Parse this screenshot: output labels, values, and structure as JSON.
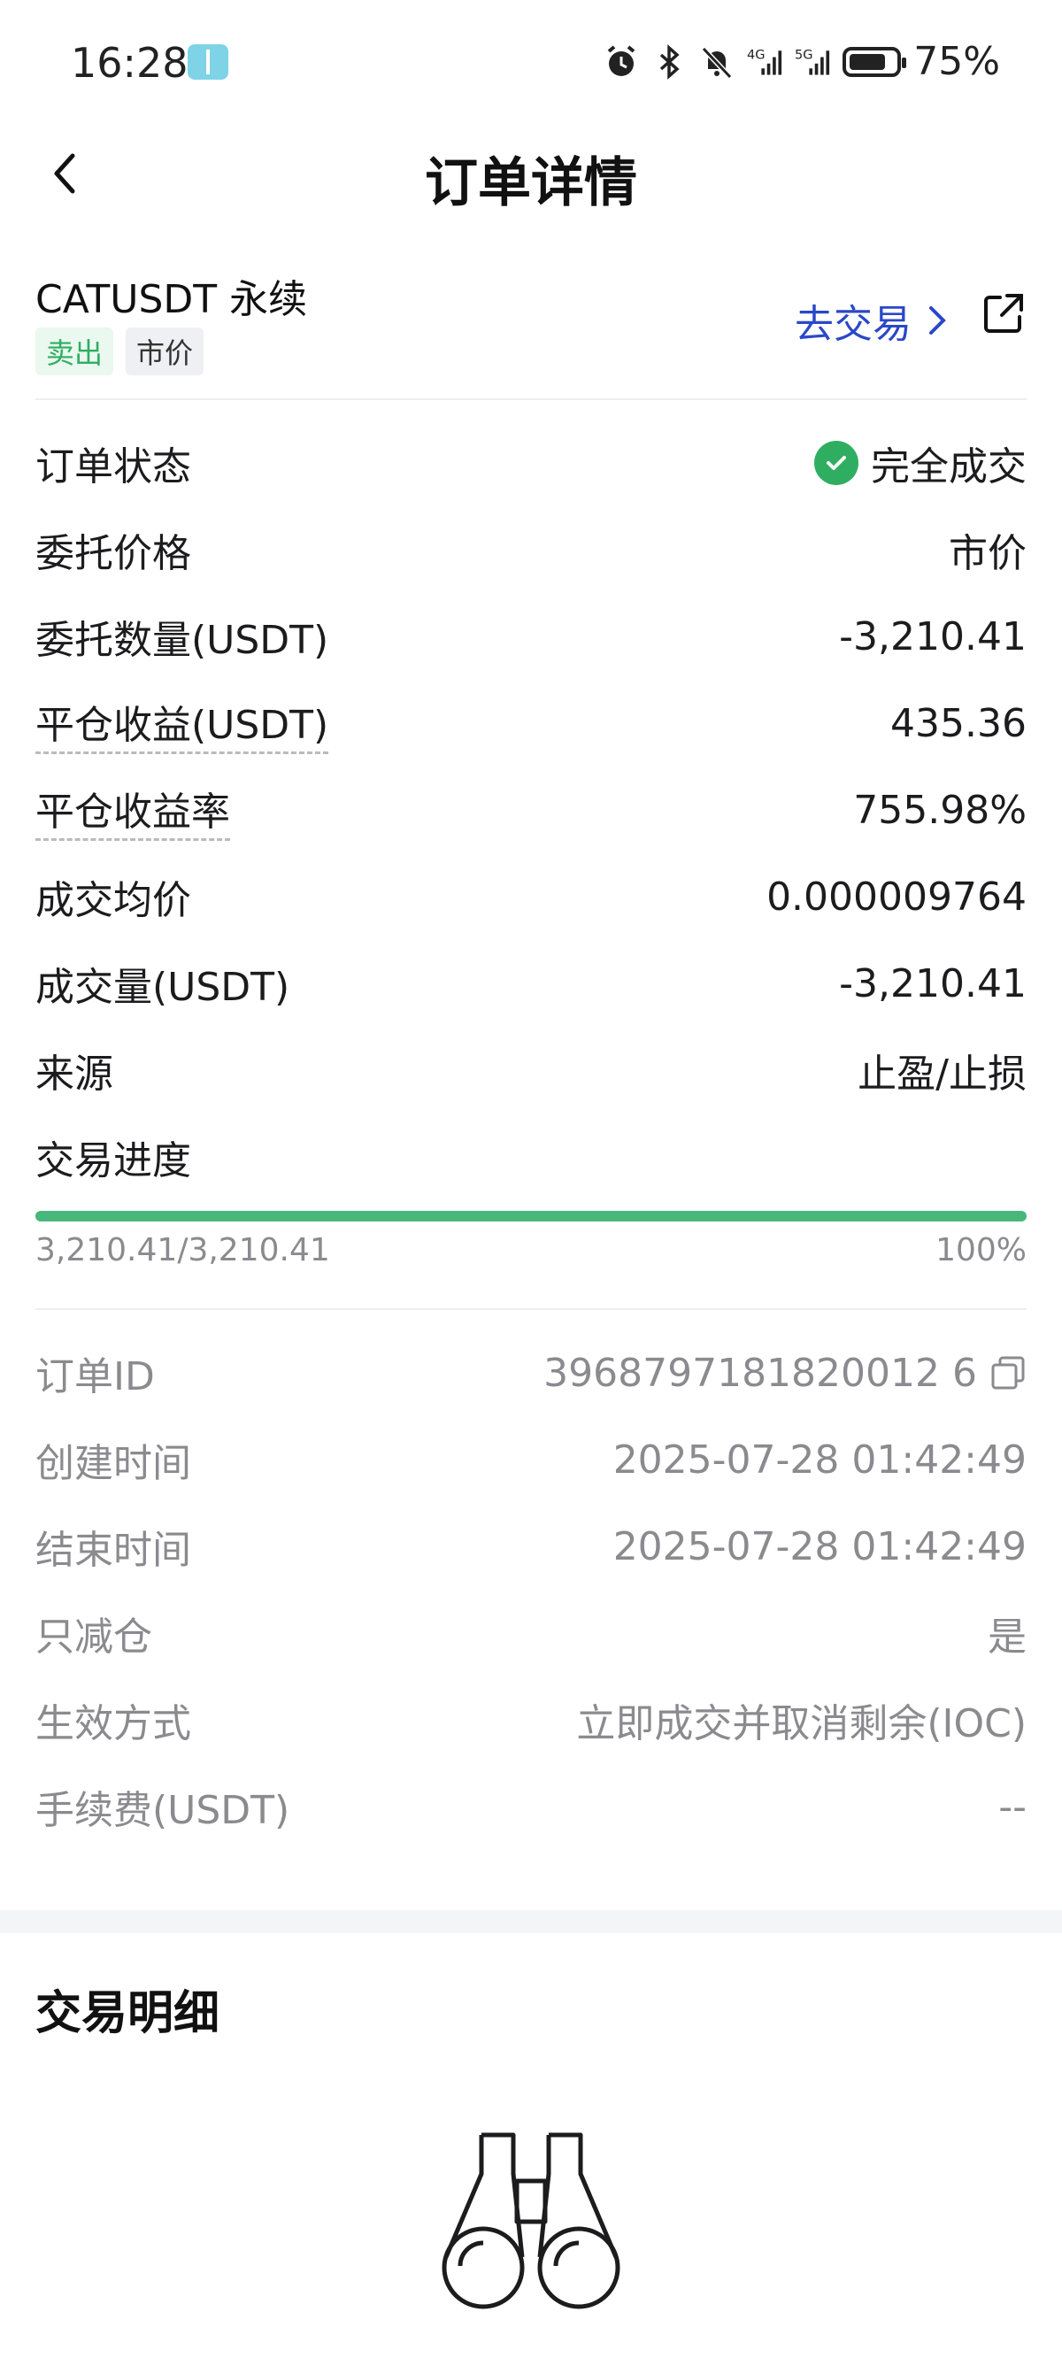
{
  "status_bar": {
    "time": "16:28",
    "battery_pct": "75%",
    "net1": "4G",
    "net2": "5G",
    "icons": [
      "app-book-icon",
      "alarm-icon",
      "bluetooth-icon",
      "mute-bell-icon",
      "signal-4g-icon",
      "signal-5g-icon",
      "battery-icon"
    ]
  },
  "navbar": {
    "title": "订单详情"
  },
  "header": {
    "pair": "CATUSDT 永续",
    "side_tag": "卖出",
    "type_tag": "市价",
    "go_trade": "去交易",
    "colors": {
      "buy_sell_green": "#2fae62",
      "link_blue": "#2a48c8"
    }
  },
  "details": [
    {
      "key": "订单状态",
      "value": "完全成交",
      "icon": "check-circle-icon"
    },
    {
      "key": "委托价格",
      "value": "市价"
    },
    {
      "key": "委托数量(USDT)",
      "value": "-3,210.41"
    },
    {
      "key": "平仓收益(USDT)",
      "value": "435.36",
      "dashed": true
    },
    {
      "key": "平仓收益率",
      "value": "755.98%",
      "dashed": true
    },
    {
      "key": "成交均价",
      "value": "0.000009764"
    },
    {
      "key": "成交量(USDT)",
      "value": "-3,210.41"
    },
    {
      "key": "来源",
      "value": "止盈/止损"
    }
  ],
  "progress": {
    "label": "交易进度",
    "filled": "3,210.41/3,210.41",
    "percent_text": "100%",
    "fraction": 1.0,
    "color": "#48b77a"
  },
  "meta": [
    {
      "key": "订单ID",
      "value": "3968797181820012 6",
      "icon": "copy-icon"
    },
    {
      "key": "创建时间",
      "value": "2025-07-28 01:42:49"
    },
    {
      "key": "结束时间",
      "value": "2025-07-28 01:42:49"
    },
    {
      "key": "只减仓",
      "value": "是"
    },
    {
      "key": "生效方式",
      "value": "立即成交并取消剩余(IOC)"
    },
    {
      "key": "手续费(USDT)",
      "value": "--"
    }
  ],
  "trade_detail": {
    "title": "交易明细",
    "empty_icon": "binoculars-icon"
  }
}
